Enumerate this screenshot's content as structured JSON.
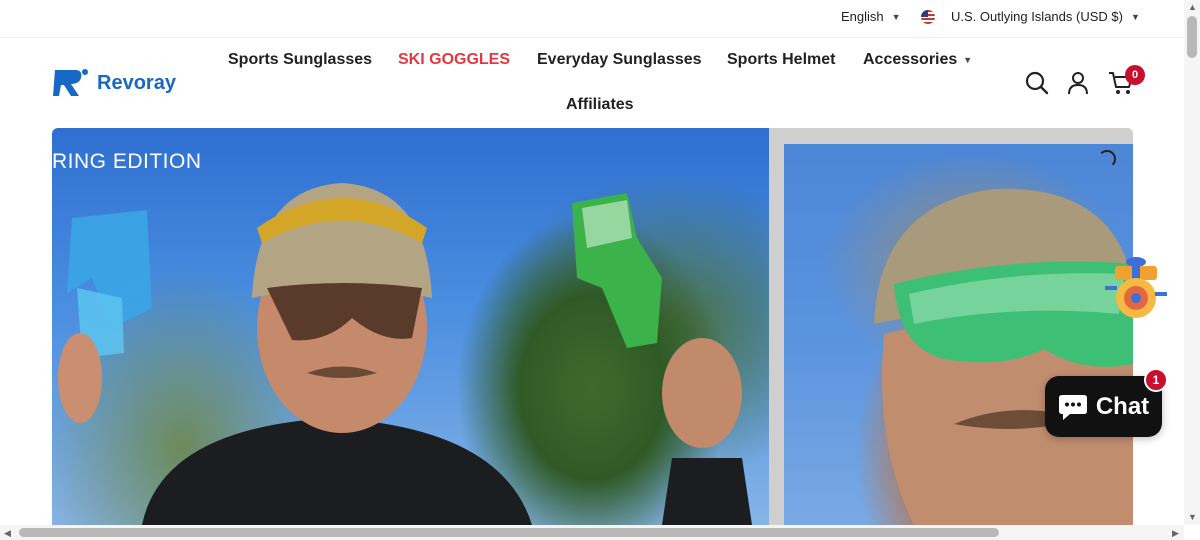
{
  "topbar": {
    "language": "English",
    "country": "U.S. Outlying Islands (USD $)"
  },
  "header": {
    "logo_text": "Revoray",
    "nav": [
      {
        "label": "Sports Sunglasses"
      },
      {
        "label": "SKI GOGGLES",
        "color": "#e5373f"
      },
      {
        "label": "Everyday Sunglasses"
      },
      {
        "label": "Sports Helmet"
      },
      {
        "label": "Accessories"
      },
      {
        "label": "Affiliates"
      }
    ],
    "icons": [
      "search-icon",
      "account-icon",
      "cart-icon"
    ],
    "cart_count": "0"
  },
  "hero": {
    "caption": "RING EDITION"
  },
  "chat": {
    "label": "Chat",
    "badge": "1"
  },
  "colors": {
    "brand": "#1769c4",
    "accent_red": "#e5373f",
    "badge_red": "#c8102e"
  }
}
